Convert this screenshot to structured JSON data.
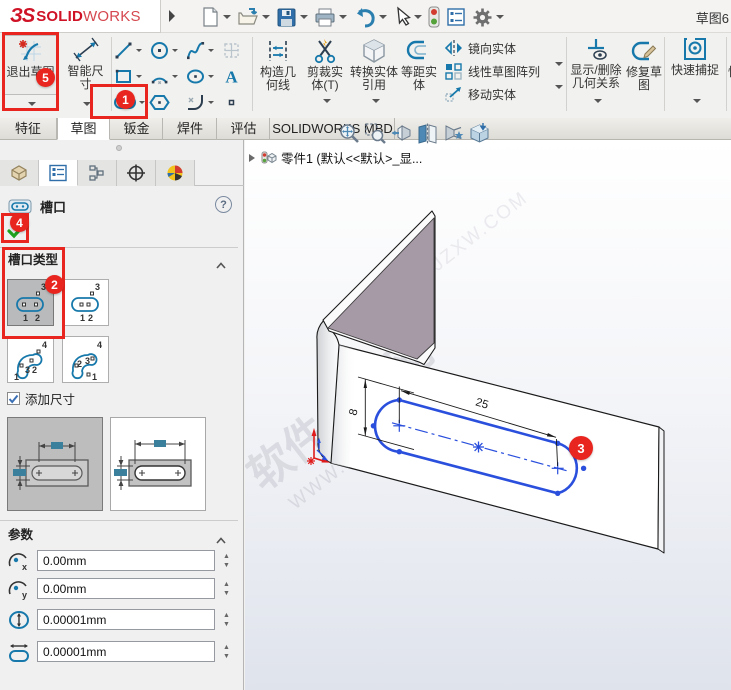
{
  "brand": {
    "mark": "ЗS",
    "bold": "SOLID",
    "light": "WORKS"
  },
  "title": {
    "doc": "草图6"
  },
  "ribbon": {
    "exit_sketch": "退出草图",
    "smart_dimension": "智能尺寸",
    "text_tool_glyph": "A",
    "construction": "构造几何线",
    "trim": "剪裁实体(T)",
    "convert": "转换实体引用",
    "offset": "等距实体",
    "mirror": "镜向实体",
    "pattern": "线性草图阵列",
    "move": "移动实体",
    "relations": "显示/删除几何关系",
    "repair": "修复草图",
    "snaps": "快速捕捉",
    "partial": "快"
  },
  "tabs": {
    "items": [
      "特征",
      "草图",
      "钣金",
      "焊件",
      "评估",
      "SOLIDWORKS MBD"
    ],
    "active": "草图"
  },
  "panel": {
    "title": "槽口",
    "help": "?",
    "slot_type": {
      "label": "槽口类型",
      "buttons": [
        {
          "name": "straight-slot-centers",
          "digits": [
            "1",
            "2",
            "3"
          ]
        },
        {
          "name": "straight-slot-overall",
          "digits": [
            "1",
            "2",
            "3"
          ]
        },
        {
          "name": "three-point-arc-slot",
          "digits": [
            "1",
            "2",
            "3",
            "4"
          ]
        },
        {
          "name": "centerpoint-arc-slot",
          "digits": [
            "1",
            "2",
            "3",
            "4"
          ]
        }
      ]
    },
    "add_dimensions": {
      "label": "添加尺寸",
      "checked": true
    },
    "parameters": {
      "label": "参数",
      "sub": {
        "x": "x",
        "y": "y"
      },
      "fields": [
        {
          "icon": "center-x",
          "value": "0.00mm"
        },
        {
          "icon": "center-y",
          "value": "0.00mm"
        },
        {
          "icon": "slot-width",
          "value": "0.00001mm"
        },
        {
          "icon": "slot-length",
          "value": "0.00001mm"
        }
      ]
    }
  },
  "viewport": {
    "tree_item": "零件1 (默认<<默认>_显...",
    "dim_length": "25",
    "dim_width": "8",
    "watermark1": "软件自学网",
    "watermark2": "WWW.RJZXW.COM"
  },
  "annotations": {
    "steps": [
      "1",
      "2",
      "3",
      "4",
      "5"
    ]
  }
}
